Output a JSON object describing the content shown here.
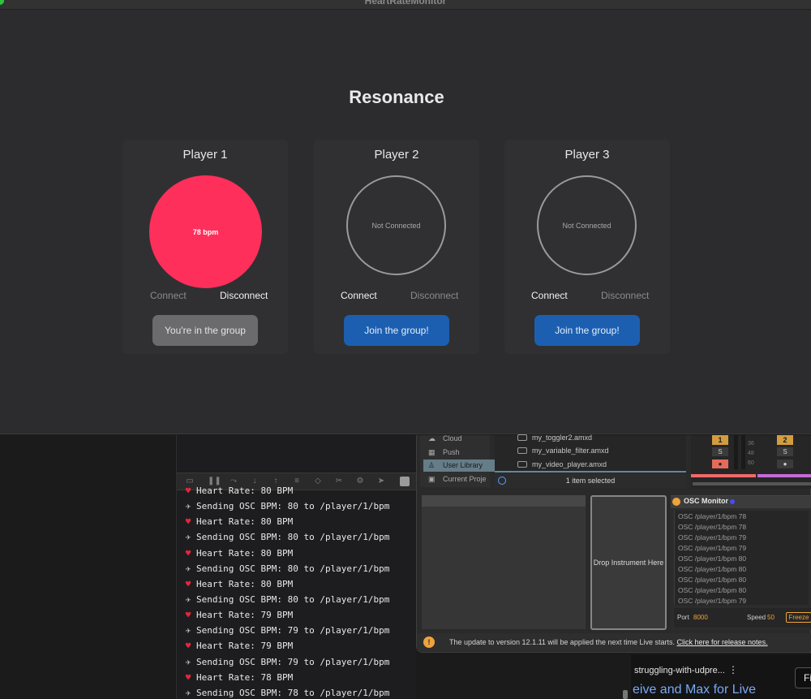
{
  "window": {
    "title": "HeartRateMonitor",
    "heading": "Resonance"
  },
  "players": [
    {
      "name": "Player 1",
      "status_text": "78 bpm",
      "connected": true,
      "connect_label": "Connect",
      "disconnect_label": "Disconnect",
      "action_label": "You're in the group"
    },
    {
      "name": "Player 2",
      "status_text": "Not Connected",
      "connected": false,
      "connect_label": "Connect",
      "disconnect_label": "Disconnect",
      "action_label": "Join the group!"
    },
    {
      "name": "Player 3",
      "status_text": "Not Connected",
      "connected": false,
      "connect_label": "Connect",
      "disconnect_label": "Disconnect",
      "action_label": "Join the group!"
    }
  ],
  "colors": {
    "active_circle": "#ff2f5b",
    "join_button": "#1c5fb1",
    "in_group_button": "#6b6b6d",
    "osc_accent": "#f0a33a"
  },
  "terminal": {
    "lines": [
      {
        "icon": "heart-icon",
        "text": "Heart Rate: 80 BPM"
      },
      {
        "icon": "satellite-icon",
        "text": "Sending OSC BPM: 80 to /player/1/bpm"
      },
      {
        "icon": "heart-icon",
        "text": "Heart Rate: 80 BPM"
      },
      {
        "icon": "satellite-icon",
        "text": "Sending OSC BPM: 80 to /player/1/bpm"
      },
      {
        "icon": "heart-icon",
        "text": "Heart Rate: 80 BPM"
      },
      {
        "icon": "satellite-icon",
        "text": "Sending OSC BPM: 80 to /player/1/bpm"
      },
      {
        "icon": "heart-icon",
        "text": "Heart Rate: 80 BPM"
      },
      {
        "icon": "satellite-icon",
        "text": "Sending OSC BPM: 80 to /player/1/bpm"
      },
      {
        "icon": "heart-icon",
        "text": "Heart Rate: 79 BPM"
      },
      {
        "icon": "satellite-icon",
        "text": "Sending OSC BPM: 79 to /player/1/bpm"
      },
      {
        "icon": "heart-icon",
        "text": "Heart Rate: 79 BPM"
      },
      {
        "icon": "satellite-icon",
        "text": "Sending OSC BPM: 79 to /player/1/bpm"
      },
      {
        "icon": "heart-icon",
        "text": "Heart Rate: 78 BPM"
      },
      {
        "icon": "satellite-icon",
        "text": "Sending OSC BPM: 78 to /player/1/bpm"
      }
    ]
  },
  "live": {
    "browser_items": [
      "Cloud",
      "Push",
      "User Library",
      "Current Proje"
    ],
    "selected_browser_item": "User Library",
    "files": [
      "my_toggler2.amxd",
      "my_variable_filter.amxd",
      "my_video_player.amxd"
    ],
    "selection_status": "1 item selected",
    "mixer": {
      "track_numbers": [
        "1",
        "2"
      ],
      "solo_label": "S",
      "meter_values": [
        "36",
        "48",
        "60"
      ]
    },
    "drop_instrument_label": "Drop Instrument Here",
    "osc_monitor": {
      "title": "OSC Monitor",
      "log": [
        "OSC /player/1/bpm 78",
        "OSC /player/1/bpm 78",
        "OSC /player/1/bpm 79",
        "OSC /player/1/bpm 79",
        "OSC /player/1/bpm 80",
        "OSC /player/1/bpm 80",
        "OSC /player/1/bpm 80",
        "OSC /player/1/bpm 80",
        "OSC /player/1/bpm 79"
      ],
      "port_label": "Port",
      "port_value": "8000",
      "speed_label": "Speed",
      "speed_value": "50",
      "freeze_label": "Freeze"
    },
    "update_message": "The update to version 12.1.11 will be applied the next time Live starts.",
    "release_notes_link": "Click here for release notes."
  },
  "youtube": {
    "video_title": "struggling-with-udpre...",
    "link_text": "eive and Max for Live",
    "button_label": "Fi"
  }
}
